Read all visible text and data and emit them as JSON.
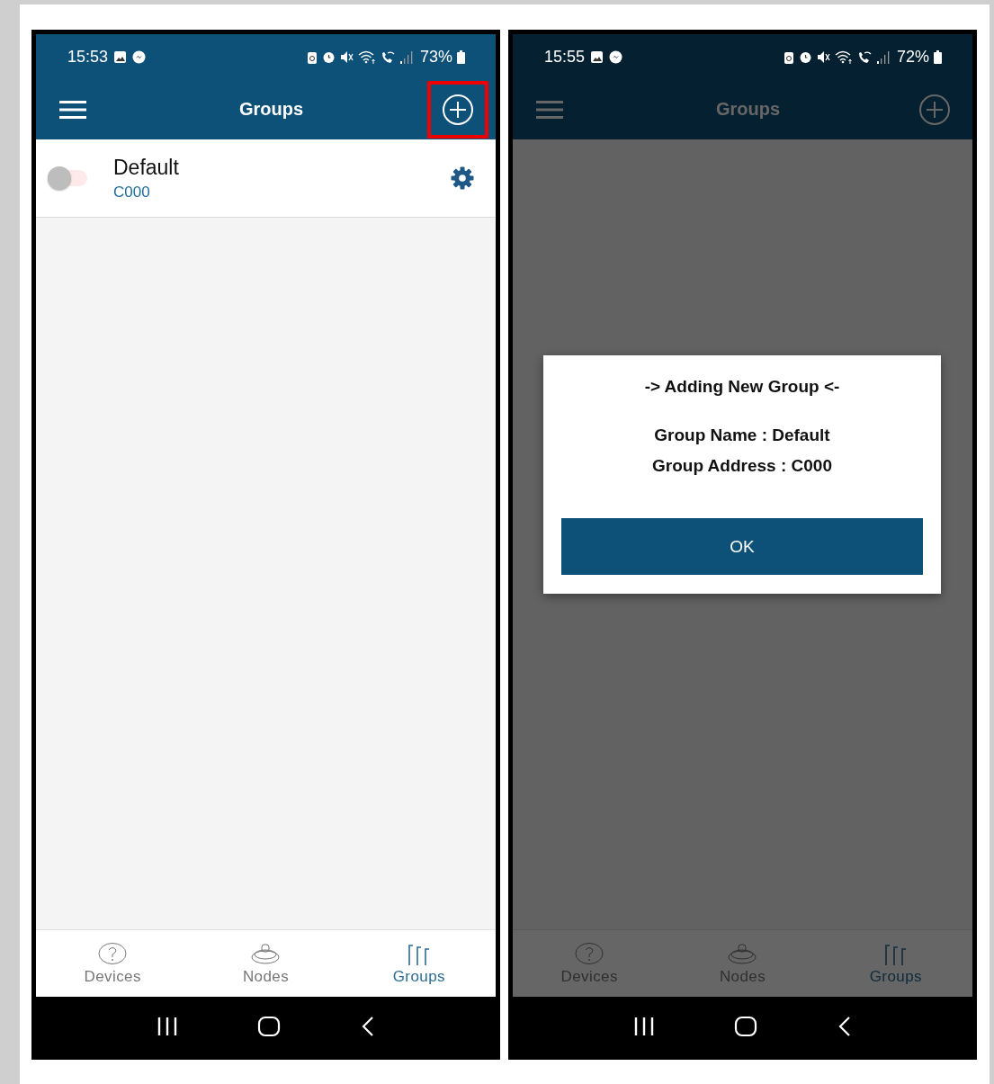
{
  "screens": [
    {
      "dimmed": false,
      "status_bar": {
        "time": "15:53",
        "battery": "73%"
      },
      "app_bar": {
        "title": "Groups",
        "add_highlighted": true
      },
      "groups": [
        {
          "name": "Default",
          "address": "C000",
          "on": false
        }
      ],
      "tabs": [
        {
          "label": "Devices",
          "kind": "devices",
          "selected": false
        },
        {
          "label": "Nodes",
          "kind": "nodes",
          "selected": false
        },
        {
          "label": "Groups",
          "kind": "groups",
          "selected": true
        }
      ]
    },
    {
      "dimmed": true,
      "status_bar": {
        "time": "15:55",
        "battery": "72%"
      },
      "app_bar": {
        "title": "Groups",
        "add_highlighted": false
      },
      "tabs": [
        {
          "label": "Devices",
          "kind": "devices",
          "selected": false
        },
        {
          "label": "Nodes",
          "kind": "nodes",
          "selected": false
        },
        {
          "label": "Groups",
          "kind": "groups",
          "selected": true
        }
      ],
      "dialog": {
        "title": "-> Adding New Group <-",
        "lines": [
          "Group Name : Default",
          "Group Address : C000"
        ],
        "button": "OK"
      }
    }
  ]
}
